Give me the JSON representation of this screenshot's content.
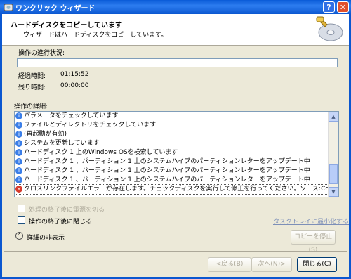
{
  "window": {
    "title": "ワンクリック ウィザード",
    "help": "?",
    "close": "✕"
  },
  "header": {
    "title": "ハードディスクをコピーしています",
    "subtitle": "ウィザードはハードディスクをコピーしています。"
  },
  "progress": {
    "label": "操作の進行状況:",
    "fraction": 0.0
  },
  "time": {
    "elapsed_label": "経過時間:",
    "elapsed_value": "01:15:52",
    "remaining_label": "残り時間:",
    "remaining_value": "00:00:00"
  },
  "details": {
    "label": "操作の詳細:",
    "rows": [
      {
        "type": "info",
        "text": "パラメータをチェックしています"
      },
      {
        "type": "info",
        "text": "ファイルとディレクトリをチェックしています"
      },
      {
        "type": "info",
        "text": "(再起動が有効)"
      },
      {
        "type": "info",
        "text": "システムを更新しています"
      },
      {
        "type": "info",
        "text": "ハードディスク 1 上のWindows OSを検索しています"
      },
      {
        "type": "info",
        "text": "ハードディスク 1 、パーティション 1 上のシステムハイブのパーティションレターをアップデート中"
      },
      {
        "type": "info",
        "text": "ハードディスク 1 、パーティション 1 上のシステムハイブのパーティションレターをアップデート中"
      },
      {
        "type": "info",
        "text": "ハードディスク 1 、パーティション 1 上のシステムハイブのパーティションレターをアップデート中"
      },
      {
        "type": "error",
        "text": "クロスリンクファイルエラーが存在します。チェックディスクを実行して修正を行ってください。ソース:Copy Works"
      }
    ]
  },
  "options": {
    "shutdown_label": "処理の終了後に電源を切る",
    "close_label": "操作の終了後に閉じる",
    "minimize_link": "タスクトレイに最小化する"
  },
  "toggle": {
    "label": "詳細の非表示",
    "icon": "chevron-up-icon"
  },
  "buttons": {
    "stop_copy": "コピーを停止(S)",
    "back": "<戻る(B)",
    "next": "次へ(N)>",
    "close": "閉じる(C)"
  },
  "colors": {
    "title_bar": "#0b57d0",
    "error_icon": "#d63a2c",
    "info_icon": "#3a7ee8"
  }
}
